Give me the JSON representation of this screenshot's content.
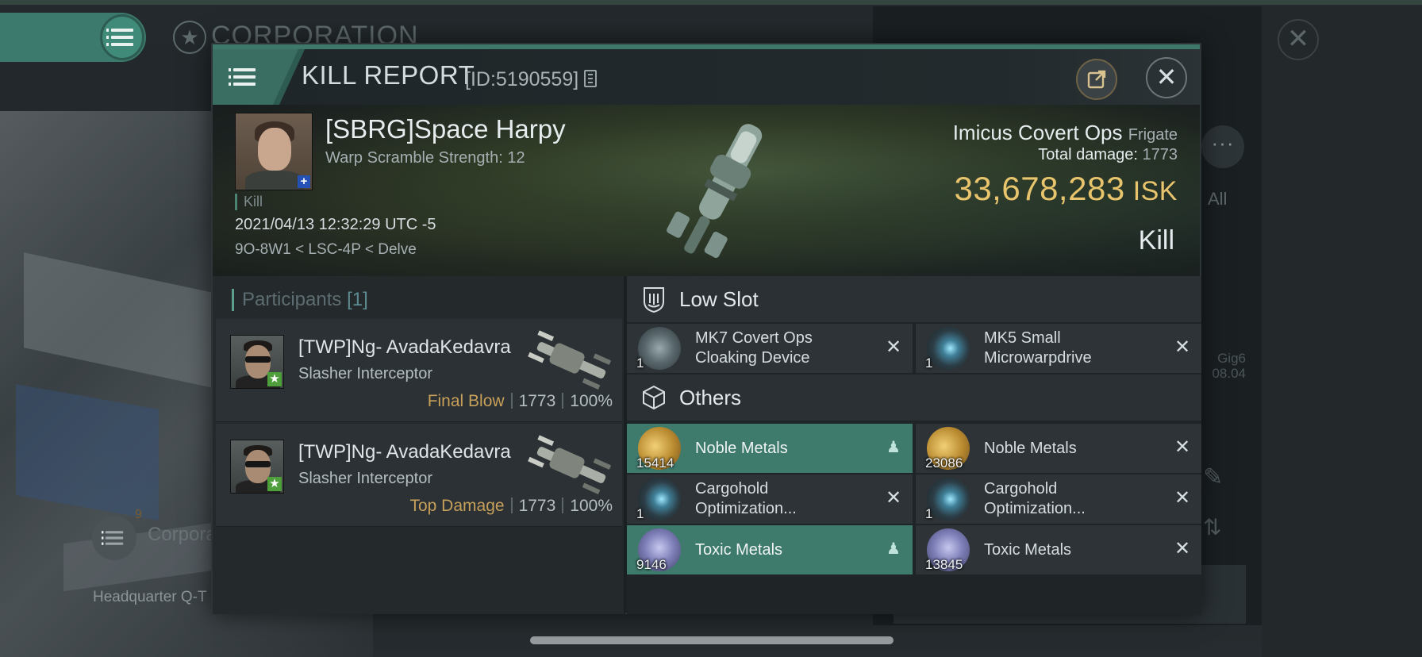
{
  "background": {
    "corporation_title": "CORPORATION",
    "corp_item_label": "Corpora",
    "corp_item_count": "9",
    "headquarter_label": "Headquarter Q-T",
    "side_all": "All",
    "side_meta_line1": "Gig6",
    "side_meta_line2": "08.04"
  },
  "header": {
    "title": "KILL REPORT",
    "report_id": "[ID:5190559]"
  },
  "victim": {
    "name": "[SBRG]Space Harpy",
    "warp_scramble": "Warp Scramble Strength: 12",
    "kill_tag": "Kill",
    "datetime": "2021/04/13 12:32:29 UTC -5",
    "location": "9O-8W1 < LSC-4P < Delve",
    "ship_name": "Imicus Covert Ops",
    "ship_class": "Frigate",
    "total_damage_label": "Total damage:",
    "total_damage_value": "1773",
    "isk_value": "33,678,283",
    "isk_unit": "ISK",
    "result": "Kill"
  },
  "participants": {
    "label": "Participants",
    "count": "[1]",
    "rows": [
      {
        "name": "[TWP]Ng- AvadaKedavra",
        "ship": "Slasher Interceptor",
        "role": "Final Blow",
        "damage": "1773",
        "percent": "100%"
      },
      {
        "name": "[TWP]Ng- AvadaKedavra",
        "ship": "Slasher Interceptor",
        "role": "Top Damage",
        "damage": "1773",
        "percent": "100%"
      }
    ]
  },
  "low_slot": {
    "label": "Low Slot",
    "items": [
      {
        "name": "MK7 Covert Ops Cloaking Device",
        "qty": "1",
        "dropped": false,
        "icon": "cloaking-device"
      },
      {
        "name": "MK5 Small Microwarpdrive",
        "qty": "1",
        "dropped": false,
        "icon": "microwarpdrive"
      }
    ]
  },
  "others": {
    "label": "Others",
    "items": [
      {
        "name": "Noble Metals",
        "qty": "15414",
        "dropped": true,
        "icon": "noble-metals"
      },
      {
        "name": "Noble Metals",
        "qty": "23086",
        "dropped": false,
        "icon": "noble-metals"
      },
      {
        "name": "Cargohold Optimization...",
        "qty": "1",
        "dropped": false,
        "icon": "cargohold-optimization"
      },
      {
        "name": "Cargohold Optimization...",
        "qty": "1",
        "dropped": false,
        "icon": "cargohold-optimization"
      },
      {
        "name": "Toxic Metals",
        "qty": "9146",
        "dropped": true,
        "icon": "toxic-metals"
      },
      {
        "name": "Toxic Metals",
        "qty": "13845",
        "dropped": false,
        "icon": "toxic-metals"
      }
    ]
  },
  "colors": {
    "accent": "#3e7b6d",
    "isk": "#e8c46c",
    "role_label": "#c7a05a"
  }
}
